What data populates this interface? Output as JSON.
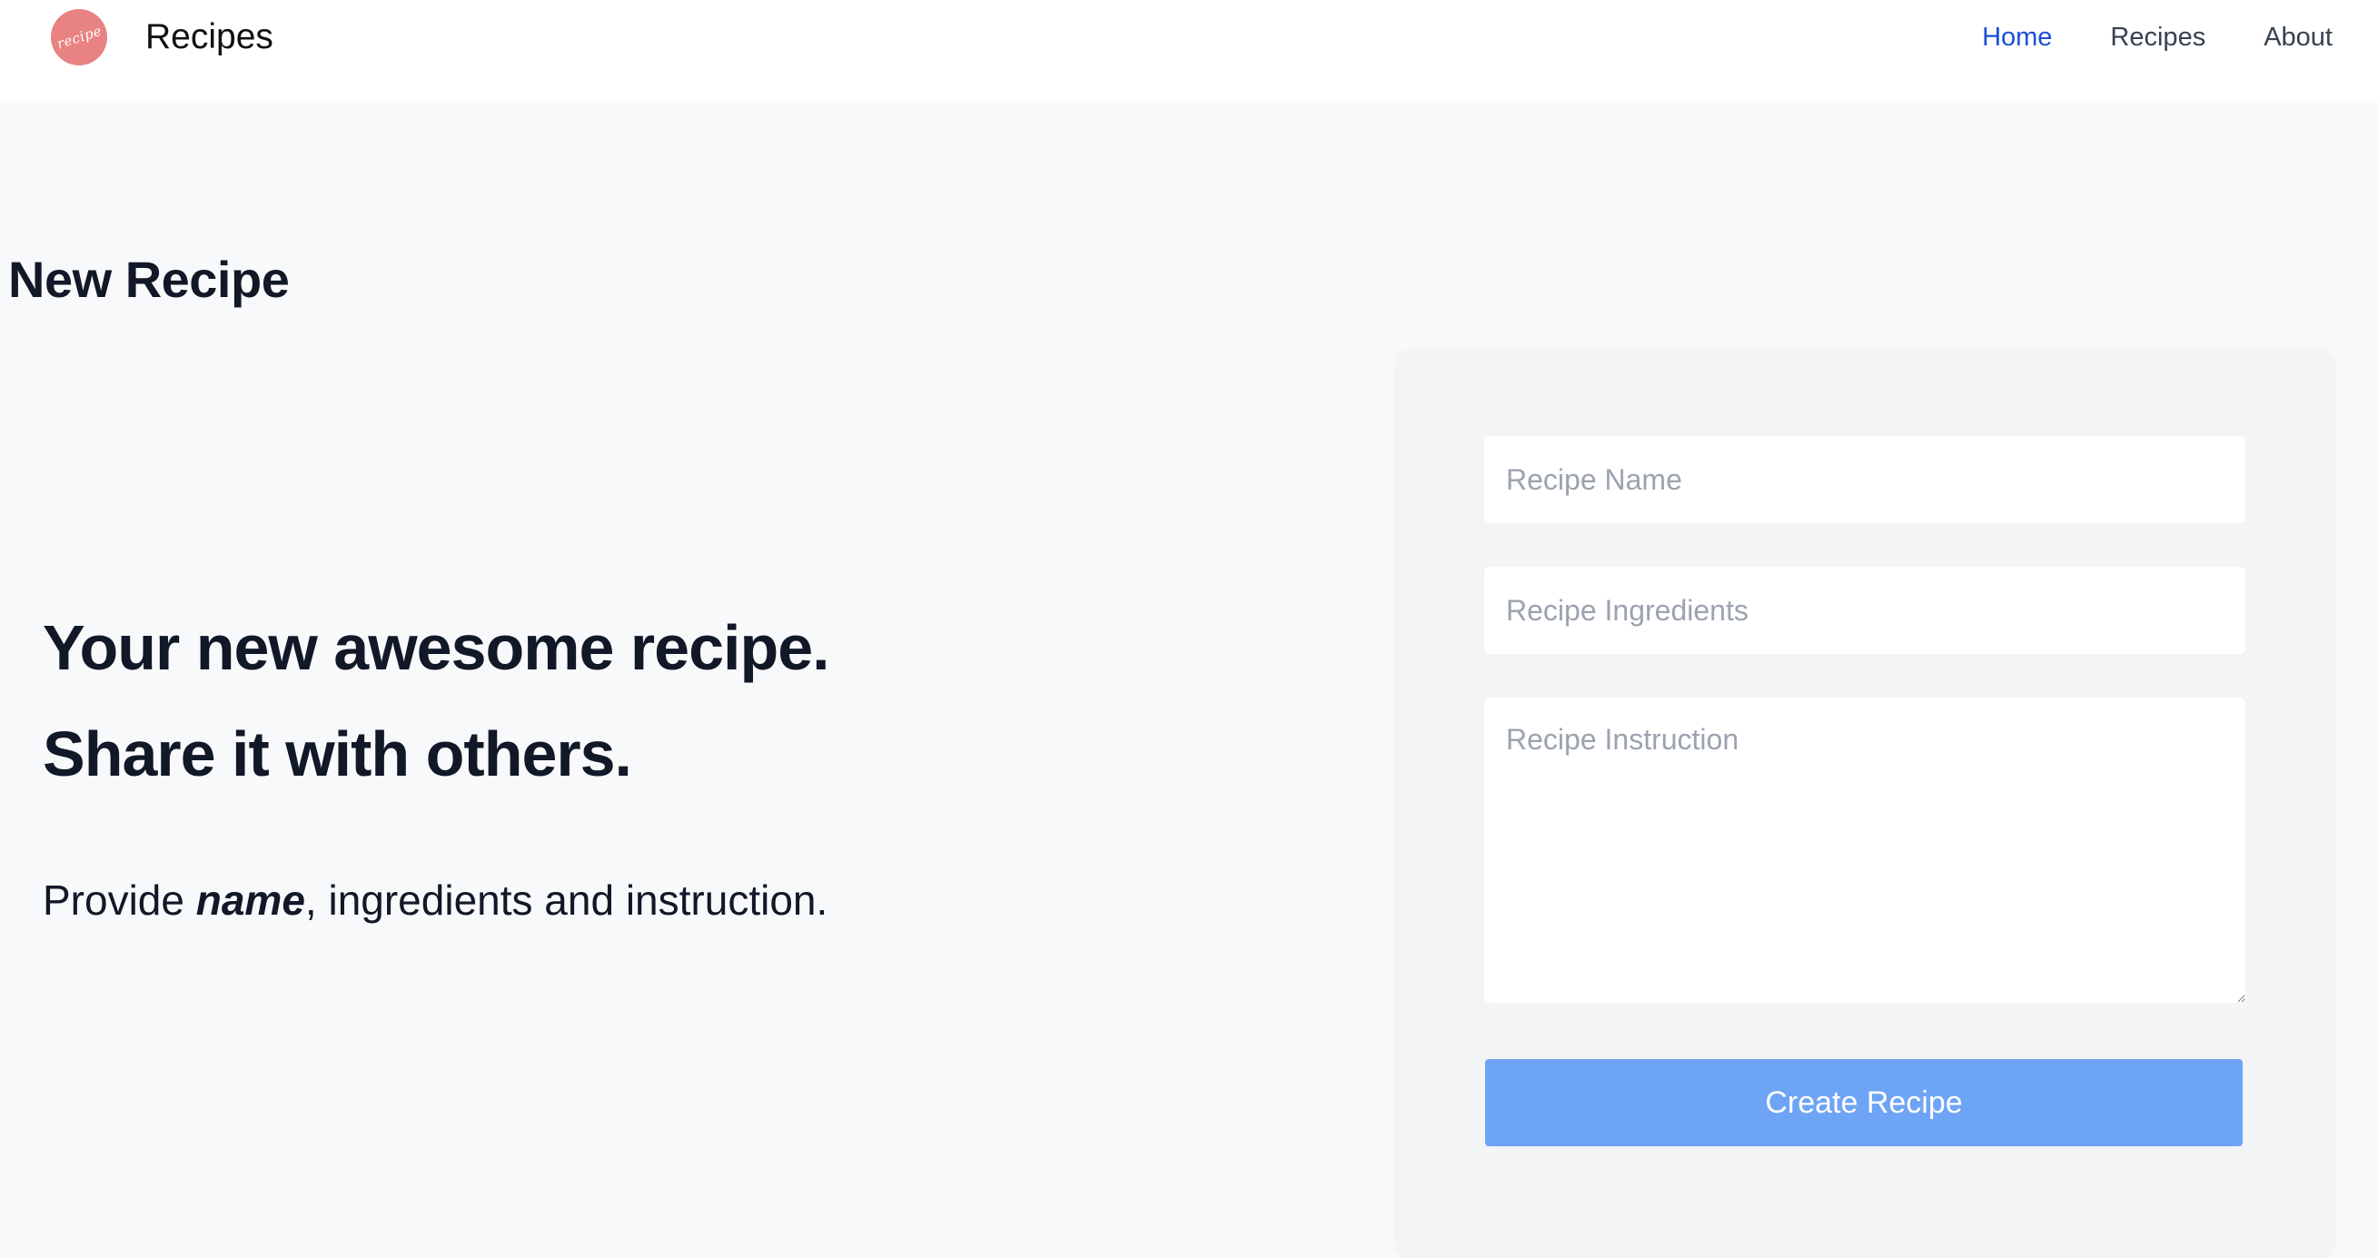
{
  "header": {
    "logo_text": "recipe",
    "brand": "Recipes",
    "nav": [
      {
        "label": "Home",
        "active": true
      },
      {
        "label": "Recipes",
        "active": false
      },
      {
        "label": "About",
        "active": false
      }
    ]
  },
  "page": {
    "title": "New Recipe"
  },
  "hero": {
    "line1": "Your new awesome recipe.",
    "line2": "Share it with others.",
    "sub_prefix": "Provide ",
    "sub_emphasis": "name",
    "sub_suffix": ", ingredients and instruction."
  },
  "form": {
    "name_placeholder": "Recipe Name",
    "ingredients_placeholder": "Recipe Ingredients",
    "instruction_placeholder": "Recipe Instruction",
    "submit_label": "Create Recipe"
  },
  "colors": {
    "accent": "#1d4ed8",
    "button": "#6ea4f5",
    "logo": "#e98282"
  }
}
